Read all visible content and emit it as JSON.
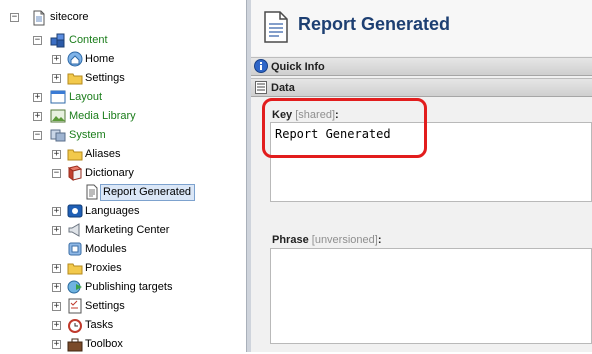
{
  "tree": {
    "nodes": {
      "sitecore": {
        "label": "sitecore",
        "toggle": "−"
      },
      "content": {
        "label": "Content",
        "toggle": "−"
      },
      "home": {
        "label": "Home",
        "toggle": "+"
      },
      "settings_content": {
        "label": "Settings",
        "toggle": "+"
      },
      "layout": {
        "label": "Layout",
        "toggle": "+"
      },
      "media_library": {
        "label": "Media Library",
        "toggle": "+"
      },
      "system": {
        "label": "System",
        "toggle": "−"
      },
      "aliases": {
        "label": "Aliases",
        "toggle": "+"
      },
      "dictionary": {
        "label": "Dictionary",
        "toggle": "−"
      },
      "report_generated": {
        "label": "Report Generated"
      },
      "languages": {
        "label": "Languages",
        "toggle": "+"
      },
      "marketing_center": {
        "label": "Marketing Center",
        "toggle": "+"
      },
      "modules": {
        "label": "Modules"
      },
      "proxies": {
        "label": "Proxies",
        "toggle": "+"
      },
      "publishing_targets": {
        "label": "Publishing targets",
        "toggle": "+"
      },
      "settings_system": {
        "label": "Settings",
        "toggle": "+"
      },
      "tasks": {
        "label": "Tasks",
        "toggle": "+"
      },
      "toolbox": {
        "label": "Toolbox",
        "toggle": "+"
      }
    }
  },
  "editor": {
    "title": "Report Generated",
    "sections": {
      "quick_info": "Quick Info",
      "data": "Data"
    },
    "fields": {
      "key": {
        "label": "Key",
        "tag": "[shared]",
        "suffix": ":",
        "value": "Report Generated"
      },
      "phrase": {
        "label": "Phrase",
        "tag": "[unversioned]",
        "suffix": ":",
        "value": ""
      }
    }
  },
  "colors": {
    "title": "#1d3f72",
    "tree_green": "#1b7d1b",
    "highlight": "#e21d1d",
    "selection": "#dbe7f7"
  }
}
